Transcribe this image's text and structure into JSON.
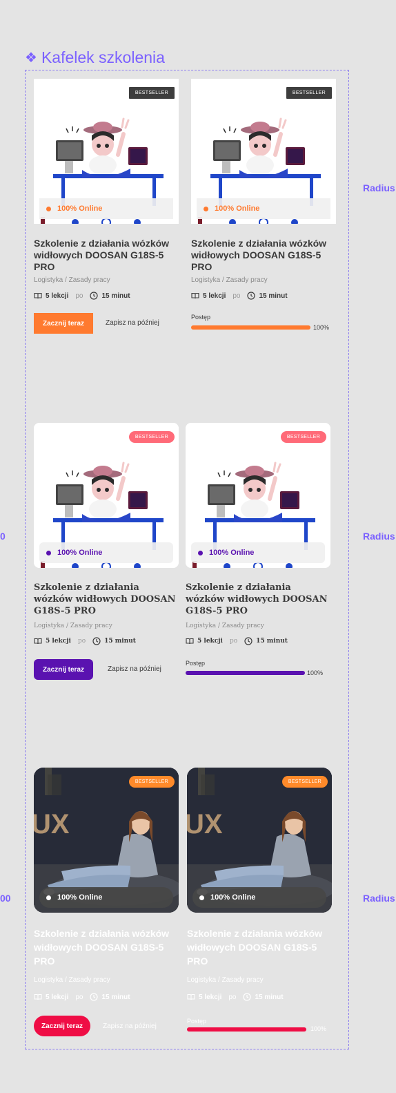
{
  "frame": {
    "title": "Kafelek szkolenia"
  },
  "side_labels": {
    "right": "Radius",
    "left_row2": "0",
    "left_row3": "00"
  },
  "colors": {
    "accent_frame": "#7b61ff",
    "orange": "#ff7a2f",
    "purple": "#5a12b0",
    "red": "#ef0d45"
  },
  "variants": [
    {
      "badge": "BESTSELLER",
      "online": "100% Online",
      "title": "Szkolenie z działania wózków widłowych DOOSAN G18S-5 PRO",
      "category": "Logistyka / Zasady pracy",
      "lessons": "5 lekcji",
      "sep": "po",
      "duration": "15 minut",
      "start_button": "Zacznij teraz",
      "save_later": "Zapisz na później",
      "progress_label": "Postęp",
      "progress_text": "100%",
      "progress_value": 1.0
    },
    {
      "badge": "BESTSELLER",
      "online": "100% Online",
      "title": "Szkolenie z działania wózków widłowych DOOSAN G18S-5 PRO",
      "category": "Logistyka / Zasady pracy",
      "lessons": "5 lekcji",
      "sep": "po",
      "duration": "15 minut",
      "start_button": "Zacznij teraz",
      "save_later": "Zapisz na później",
      "progress_label": "Postęp",
      "progress_text": "100%",
      "progress_value": 1.0
    },
    {
      "badge": "BESTSELLER",
      "online": "100% Online",
      "title": "Szkolenie z działania wózków widłowych DOOSAN G18S-5 PRO",
      "category": "Logistyka / Zasady pracy",
      "lessons": "5 lekcji",
      "sep": "po",
      "duration": "15 minut",
      "start_button": "Zacznij teraz",
      "save_later": "Zapisz na później",
      "progress_label": "Postęp",
      "progress_text": "100%",
      "progress_value": 1.0
    }
  ]
}
